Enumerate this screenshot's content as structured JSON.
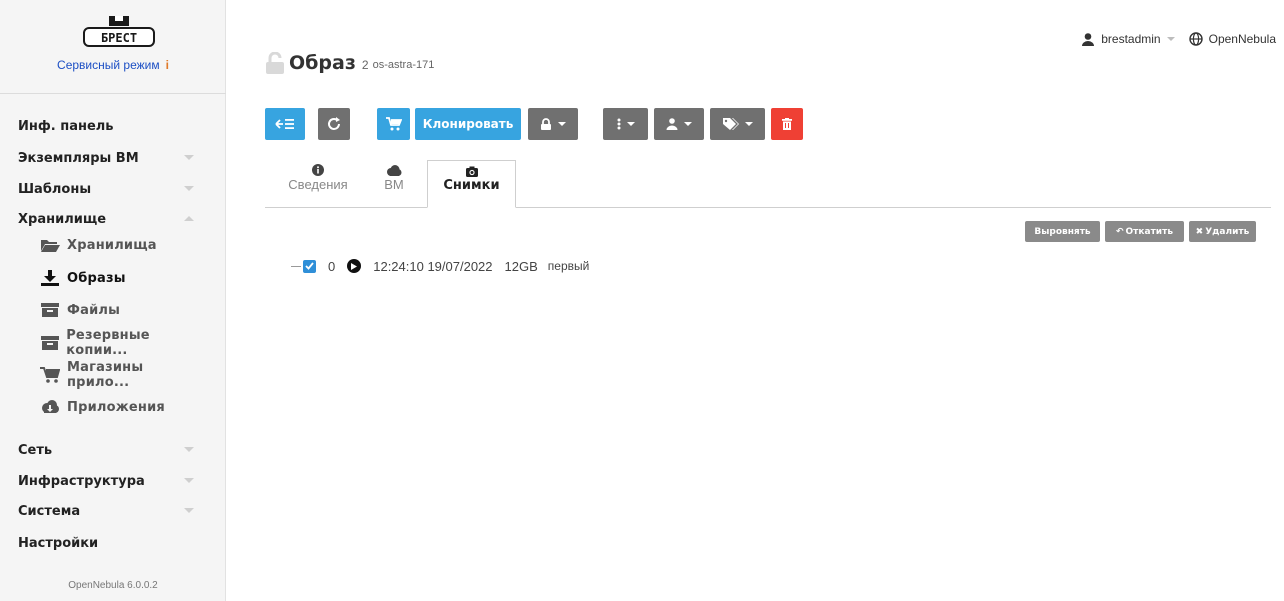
{
  "sidebar": {
    "logo_text": "БРЕСТ",
    "service_mode": "Сервисный режим",
    "warning_mark": "i",
    "items": [
      {
        "label": "Инф. панель"
      },
      {
        "label": "Экземпляры ВМ",
        "caret": "down"
      },
      {
        "label": "Шаблоны",
        "caret": "down"
      },
      {
        "label": "Хранилище",
        "caret": "up"
      },
      {
        "label": "Сеть",
        "caret": "down"
      },
      {
        "label": "Инфраструктура",
        "caret": "down"
      },
      {
        "label": "Система",
        "caret": "down"
      },
      {
        "label": "Настройки"
      }
    ],
    "storage_subitems": [
      {
        "label": "Хранилища",
        "icon": "folder-open-icon"
      },
      {
        "label": "Образы",
        "icon": "download-icon",
        "active": true
      },
      {
        "label": "Файлы",
        "icon": "archive-icon"
      },
      {
        "label": "Резервные копии...",
        "icon": "archive-icon"
      },
      {
        "label": "Магазины прило...",
        "icon": "cart-icon"
      },
      {
        "label": "Приложения",
        "icon": "cloud-download-icon"
      }
    ],
    "version": "OpenNebula 6.0.0.2"
  },
  "header": {
    "title": "Образ",
    "image_id": "2",
    "image_name": "os-astra-171",
    "user": "brestadmin",
    "zone": "OpenNebula"
  },
  "toolbar": {
    "clone_label": "Клонировать"
  },
  "tabs": [
    {
      "label": "Сведения",
      "icon": "info-icon"
    },
    {
      "label": "ВМ",
      "icon": "cloud-icon"
    },
    {
      "label": "Снимки",
      "icon": "camera-icon",
      "active": true
    }
  ],
  "snapshot_actions": {
    "flatten": "Выровнять",
    "revert": "Откатить",
    "delete": "Удалить"
  },
  "snapshots": [
    {
      "id": "0",
      "date": "12:24:10 19/07/2022",
      "size": "12GB",
      "name": "первый",
      "checked": true
    }
  ],
  "colors": {
    "accent_blue": "#37a4e0",
    "toolbar_gray": "#707070",
    "danger_red": "#ef4034",
    "link_blue": "#1c4fc4"
  }
}
